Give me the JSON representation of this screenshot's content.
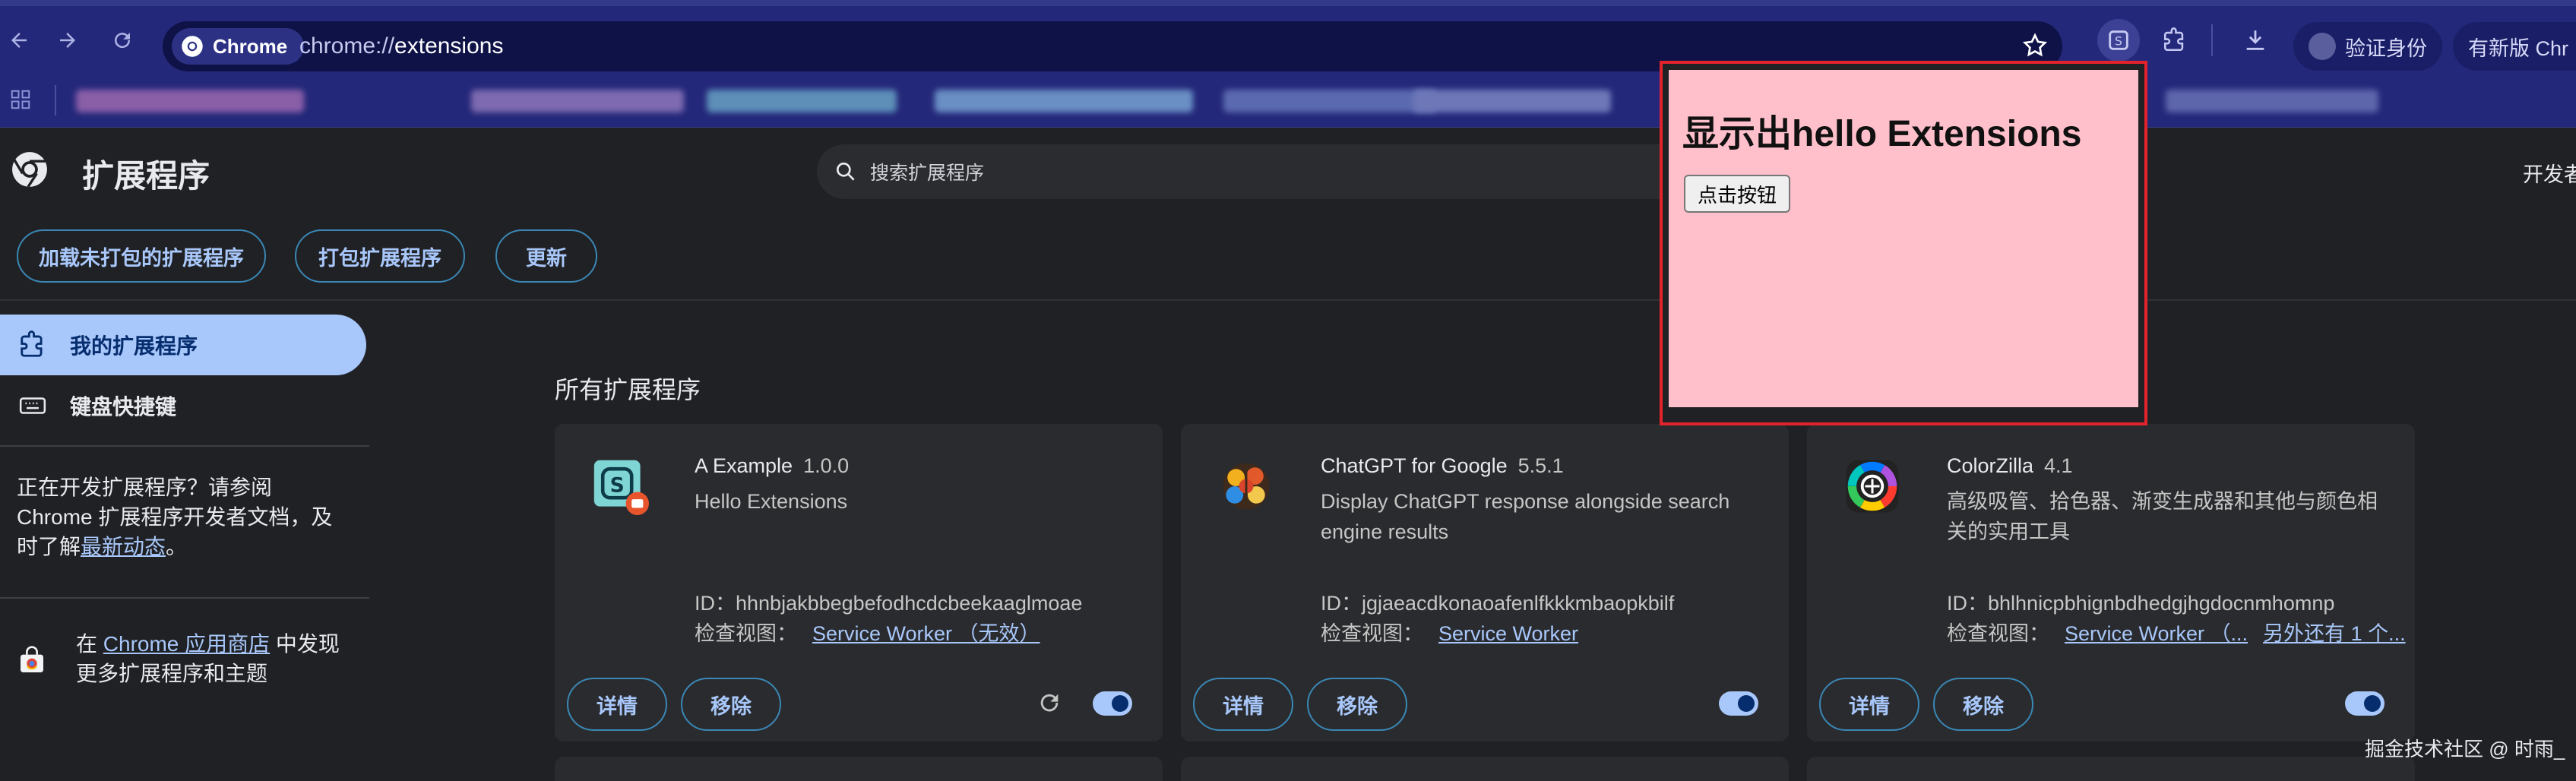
{
  "browser": {
    "chip_label": "Chrome",
    "url_prefix": "chrome://",
    "url_path": "extensions",
    "verify_label": "验证身份",
    "update_label": "有新版 Chr",
    "accent_color": "#24287a"
  },
  "header": {
    "title": "扩展程序",
    "search_placeholder": "搜索扩展程序",
    "dev_mode_label": "开发者"
  },
  "actions": {
    "load_unpacked": "加载未打包的扩展程序",
    "pack": "打包扩展程序",
    "update": "更新"
  },
  "sidebar": {
    "items": [
      {
        "label": "我的扩展程序",
        "icon": "puzzle-icon",
        "active": true
      },
      {
        "label": "键盘快捷键",
        "icon": "keyboard-icon",
        "active": false
      }
    ],
    "dev_text_1": "正在开发扩展程序？请参阅 Chrome 扩展程序开发者文档，及时了解",
    "dev_link": "最新动态",
    "dev_text_2": "。",
    "store_text_1": "在 ",
    "store_link": "Chrome 应用商店",
    "store_text_2": " 中发现更多扩展程序和主题"
  },
  "main": {
    "section_title": "所有扩展程序",
    "id_prefix": "ID：",
    "inspect_label": "检查视图：",
    "details_label": "详情",
    "remove_label": "移除",
    "extensions": [
      {
        "name": "A Example",
        "version": "1.0.0",
        "description": "Hello Extensions",
        "id": "hhnbjakbbegbefodhcdcbeekaaglmoae",
        "inspect_link": "Service Worker （无效）",
        "inspect_link_2": "",
        "enabled": true,
        "icon": "s-letter-icon"
      },
      {
        "name": "ChatGPT for Google",
        "version": "5.5.1",
        "description": "Display ChatGPT response alongside search engine results",
        "id": "jgjaeacdkonaoafenlfkkkmbaopkbilf",
        "inspect_link": "Service Worker",
        "inspect_link_2": "",
        "enabled": true,
        "icon": "brain-icon"
      },
      {
        "name": "ColorZilla",
        "version": "4.1",
        "description": "高级吸管、拾色器、渐变生成器和其他与颜色相关的实用工具",
        "id": "bhlhnicpbhignbdhedgjhgdocnmhomnp",
        "inspect_link": "Service Worker （...",
        "inspect_link_2": "另外还有 1 个...",
        "enabled": true,
        "icon": "color-wheel-icon"
      }
    ]
  },
  "popup": {
    "heading": "显示出hello Extensions",
    "button_label": "点击按钮",
    "background_color": "#ffc0cb",
    "border_color": "#e3232c"
  },
  "watermark": "掘金技术社区 @ 时雨_"
}
